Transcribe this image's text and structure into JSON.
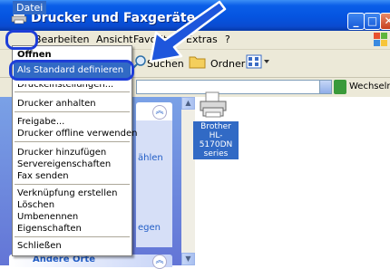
{
  "window": {
    "title": "Drucker und Faxgeräte",
    "controls": [
      "min",
      "max",
      "close"
    ]
  },
  "menubar": {
    "items": [
      "Datei",
      "Bearbeiten",
      "Ansicht",
      "Favoriten",
      "Extras",
      "?"
    ]
  },
  "toolbar": {
    "search_label": "Suchen",
    "folders_label": "Ordner"
  },
  "addressbar": {
    "go_label": "Wechseln zu"
  },
  "taskpane": {
    "fragment1": "ählen",
    "fragment2": "egen",
    "other_places": "Andere Orte"
  },
  "content": {
    "printer_label": "Brother HL-5170DN series"
  },
  "file_menu": {
    "open": "Öffnen",
    "set_default": "Als Standard definieren",
    "print_prefs": "Druckeinstellungen...",
    "pause": "Drucker anhalten",
    "share": "Freigabe...",
    "offline": "Drucker offline verwenden",
    "add_printer": "Drucker hinzufügen",
    "server_props": "Servereigenschaften",
    "send_fax": "Fax senden",
    "create_shortcut": "Verknüpfung erstellen",
    "delete": "Löschen",
    "rename": "Umbenennen",
    "properties": "Eigenschaften",
    "close": "Schließen"
  },
  "colors": {
    "title_blue": "#0554e0",
    "selection": "#316ac5",
    "highlight_ring": "#1e3ed8"
  }
}
